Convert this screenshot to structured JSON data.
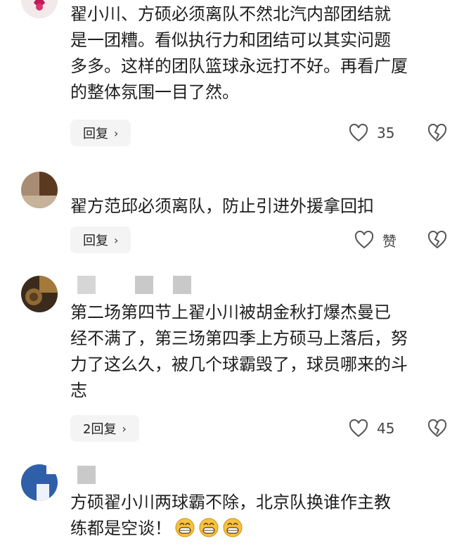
{
  "comments": [
    {
      "text": "翟小川、方硕必须离队不然北汽内部团结就\n是一团糟。看似执行力和团结可以其实问题\n多多。这样的团队篮球永远打不好。再看广厦\n的整体氛围一目了然。",
      "reply_label": "回复",
      "like_count": "35"
    },
    {
      "text": "翟方范邱必须离队，防止引进外援拿回扣",
      "reply_label": "回复",
      "like_count": "赞"
    },
    {
      "text": "第二场第四节上翟小川被胡金秋打爆杰曼已\n经不满了，第三场第四季上方硕马上落后，努\n力了这么久，被几个球霸毁了，球员哪来的斗\n志",
      "reply_label": "2回复",
      "like_count": "45"
    },
    {
      "text": "方硕翟小川两球霸不除，北京队换谁作主教\n练都是空谈！",
      "emojis": [
        "grin-emoji",
        "grin-emoji",
        "grin-emoji"
      ]
    }
  ],
  "colors": {
    "text": "#1e1e1e",
    "reply_bg": "#f4f4f4",
    "icon": "#555555",
    "emoji_yellow": "#f7c23b"
  }
}
